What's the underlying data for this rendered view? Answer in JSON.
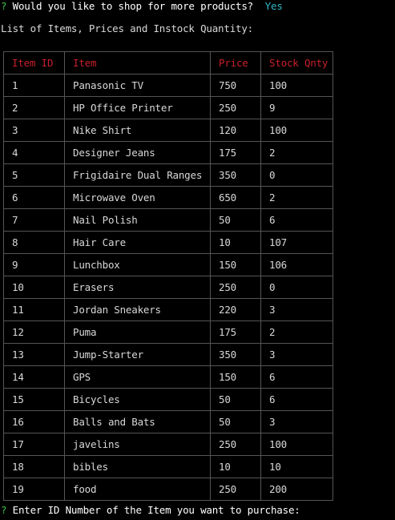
{
  "colors": {
    "background": "#000000",
    "prompt_marker": "#3ec14a",
    "answer": "#2fb7c4",
    "header_text": "#c8202a",
    "body_text": "#d8d8d8",
    "border": "#555555"
  },
  "prompt1": {
    "marker": "?",
    "question": "Would you like to shop for more products?",
    "answer": "Yes"
  },
  "list_heading": "List of Items, Prices and Instock Quantity:",
  "table": {
    "headers": [
      "Item ID",
      "Item",
      "Price",
      "Stock Qnty"
    ],
    "rows": [
      [
        "1",
        "Panasonic TV",
        "750",
        "100"
      ],
      [
        "2",
        "HP Office Printer",
        "250",
        "9"
      ],
      [
        "3",
        "Nike Shirt",
        "120",
        "100"
      ],
      [
        "4",
        "Designer Jeans",
        "175",
        "2"
      ],
      [
        "5",
        "Frigidaire Dual Ranges",
        "350",
        "0"
      ],
      [
        "6",
        "Microwave Oven",
        "650",
        "2"
      ],
      [
        "7",
        "Nail Polish",
        "50",
        "6"
      ],
      [
        "8",
        "Hair Care",
        "10",
        "107"
      ],
      [
        "9",
        "Lunchbox",
        "150",
        "106"
      ],
      [
        "10",
        "Erasers",
        "250",
        "0"
      ],
      [
        "11",
        "Jordan Sneakers",
        "220",
        "3"
      ],
      [
        "12",
        "Puma",
        "175",
        "2"
      ],
      [
        "13",
        "Jump-Starter",
        "350",
        "3"
      ],
      [
        "14",
        "GPS",
        "150",
        "6"
      ],
      [
        "15",
        "Bicycles",
        "50",
        "6"
      ],
      [
        "16",
        "Balls and Bats",
        "50",
        "3"
      ],
      [
        "17",
        "javelins",
        "250",
        "100"
      ],
      [
        "18",
        "bibles",
        "10",
        "10"
      ],
      [
        "19",
        "food",
        "250",
        "200"
      ]
    ]
  },
  "prompt2": {
    "marker": "?",
    "question": "Enter ID Number of the Item you want to purchase:"
  }
}
